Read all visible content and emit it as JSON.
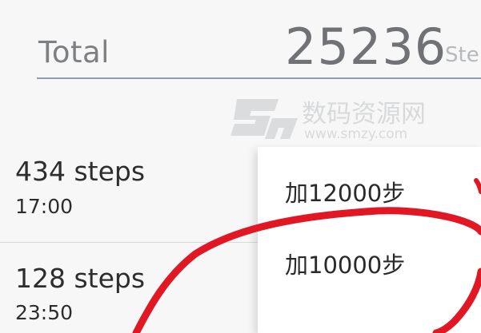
{
  "summary": {
    "label": "Total",
    "value": "25236",
    "unit": "Ste"
  },
  "records": [
    {
      "steps": "434 steps",
      "time": "17:00"
    },
    {
      "steps": "128 steps",
      "time": "23:50"
    }
  ],
  "popup_menu": {
    "items": [
      {
        "label": "加12000步"
      },
      {
        "label": "加10000步"
      }
    ]
  },
  "watermark": {
    "site_name": "数码资源网",
    "url": "www.smzy.com"
  },
  "colors": {
    "background": "#f7f7f7",
    "underline": "#8a9db6",
    "annotation_red": "#e11824"
  }
}
